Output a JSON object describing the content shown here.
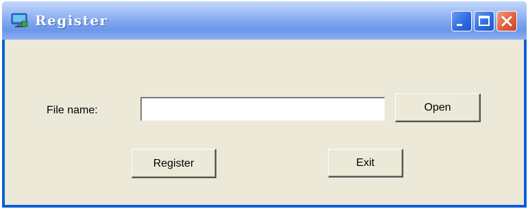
{
  "window": {
    "title": "Register",
    "icon": "app-icon"
  },
  "titlebar_buttons": {
    "minimize_icon": "minimize-icon",
    "maximize_icon": "maximize-icon",
    "close_icon": "close-icon"
  },
  "form": {
    "file_label": "File name:",
    "file_value": "",
    "open_label": "Open",
    "register_label": "Register",
    "exit_label": "Exit"
  },
  "colors": {
    "titlebar": "#7ea5ee",
    "client_bg": "#ece9d8",
    "close_button": "#e2603e"
  }
}
